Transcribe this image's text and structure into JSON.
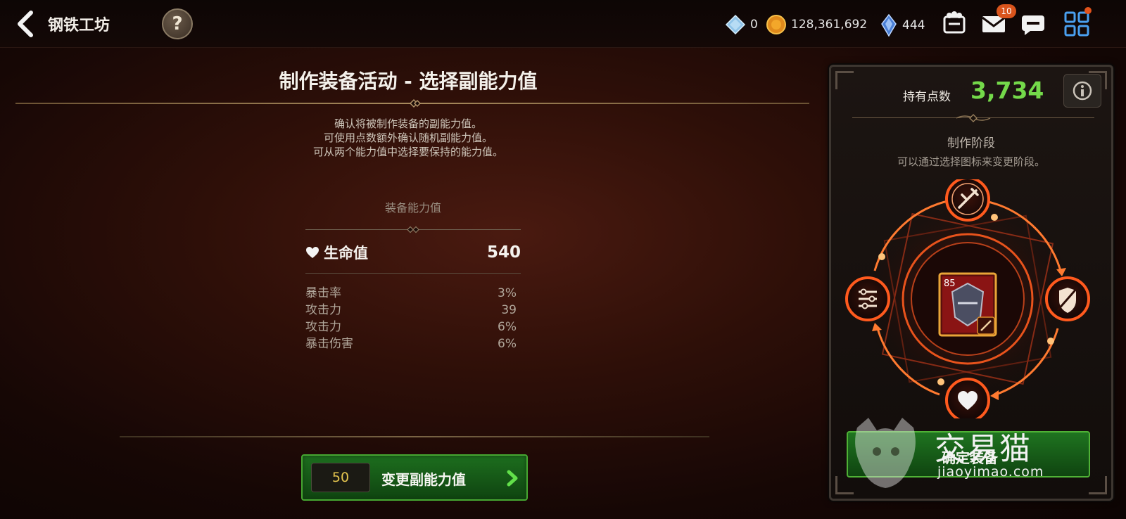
{
  "header": {
    "title": "钢铁工坊",
    "help_label": "?",
    "currencies": [
      {
        "icon": "crystal-icon",
        "value": "0"
      },
      {
        "icon": "gold-coin-icon",
        "value": "128,361,692"
      },
      {
        "icon": "blue-gem-icon",
        "value": "444"
      }
    ],
    "mail_badge": "10"
  },
  "main": {
    "title": "制作装备活动 - 选择副能力值",
    "description": [
      "确认将被制作装备的副能力值。",
      "可使用点数额外确认随机副能力值。",
      "可从两个能力值中选择要保持的能力值。"
    ],
    "stats_heading": "装备能力值",
    "main_stat": {
      "label": "生命值",
      "value": "540"
    },
    "sub_stats": [
      {
        "label": "暴击率",
        "value": "3%"
      },
      {
        "label": "攻击力",
        "value": "39"
      },
      {
        "label": "攻击力",
        "value": "6%"
      },
      {
        "label": "暴击伤害",
        "value": "6%"
      }
    ],
    "change_button": {
      "cost": "50",
      "label": "变更副能力值"
    }
  },
  "side_panel": {
    "points_label": "持有点数",
    "points_value": "3,734",
    "stage_title": "制作阶段",
    "stage_desc": "可以通过选择图标来变更阶段。",
    "item_level": "85",
    "confirm_label": "确定装备"
  },
  "watermark": {
    "text": "交易猫",
    "url": "jiaoyimao.com"
  },
  "colors": {
    "accent_green": "#74d94a",
    "button_green": "#1d6e1e",
    "ring_orange": "#e8531c",
    "gold_text": "#e4c54f"
  }
}
